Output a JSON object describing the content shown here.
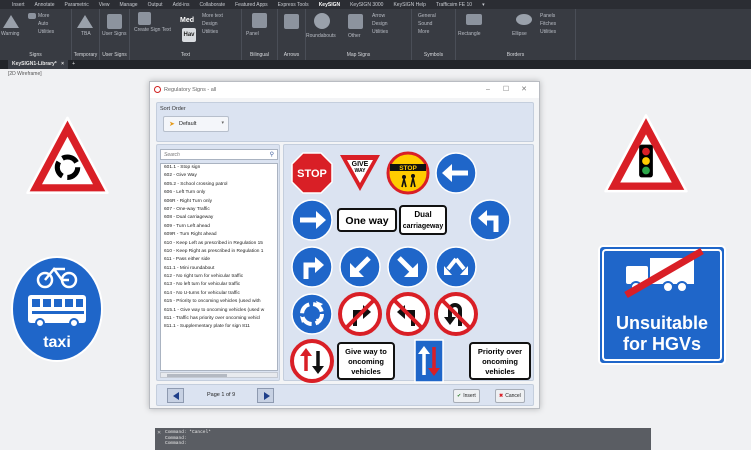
{
  "menubar": [
    "Insert",
    "Annotate",
    "Parametric",
    "View",
    "Manage",
    "Output",
    "Add-ins",
    "Collaborate",
    "Featured Apps",
    "Express Tools",
    "KeySIGN",
    "KeySIGN 3000",
    "KeySIGN Help",
    "Trafficsim FE 10",
    "▾"
  ],
  "ribbon": {
    "panels": [
      "Signs",
      "Temporary",
      "User Signs",
      "Text",
      "Bilingual",
      "Arrows",
      "Map Signs",
      "Symbols",
      "Borders"
    ],
    "items": {
      "more": "More",
      "warning": "Warning",
      "auto": "Auto",
      "utilities": "Utilities",
      "tba": "TBA",
      "user_signs": "User Signs",
      "med": "Med",
      "more_text": "More text",
      "design": "Design",
      "create_sign_text": "Create Sign Text",
      "hav": "Hav",
      "panel": "Panel",
      "roundabouts": "Roundabouts",
      "other": "Other",
      "arrow": "Arrow",
      "general": "General",
      "sound": "Sound",
      "rectangle": "Rectangle",
      "ellipse": "Ellipse",
      "panels": "Panels",
      "fitches": "Fitches"
    }
  },
  "tabs": {
    "drawing": "KeySIGN1-Library*",
    "close": "×",
    "add": "+"
  },
  "viewport_label": "[2D Wireframe]",
  "bg_signs": {
    "taxi_text": "taxi",
    "hgv_line1": "Unsuitable",
    "hgv_line2": "for HGVs"
  },
  "dialog": {
    "title": "Regulatory Signs - all",
    "sort_label": "Sort Order",
    "sort_value": "Default",
    "search_placeholder": "Search",
    "items": [
      "601.1 - Stop sign",
      "602 - Give Way",
      "605.2 - School crossing patrol",
      "606 - Left Turn only",
      "606R - Right Turn only",
      "607 - One-way Traffic",
      "608 - Dual carriageway",
      "609 - Turn Left ahead",
      "609R - Turn Right ahead",
      "610 - Keep Left as prescribed in Regulation 15",
      "610 - Keep Right as prescribed in Regulation 1",
      "611 - Pass either side",
      "611.1 - Mini roundabout",
      "612 - No right turn for vehicular traffic",
      "613 - No left turn for vehicular traffic",
      "614 - No U-turns for vehicular traffic",
      "615 - Priority to oncoming vehicles (used with",
      "615.1 - Give way to oncoming vehicles (used w",
      "811 - Traffic has priority over oncoming vehicl",
      "811.1 - Supplementary plate for sign 811"
    ],
    "signs": {
      "stop": "STOP",
      "give_way_1": "GIVE",
      "give_way_2": "WAY",
      "school_stop": "STOP",
      "one_way": "One way",
      "dual_1": "Dual",
      "dual_2": "carriageway",
      "give_oncoming_1": "Give way to",
      "give_oncoming_2": "oncoming",
      "give_oncoming_3": "vehicles",
      "priority_1": "Priority over",
      "priority_2": "oncoming",
      "priority_3": "vehicles"
    },
    "page_text": "Page 1 of 9",
    "insert_label": "Insert",
    "cancel_label": "Cancel"
  },
  "command_lines": [
    "Command: *Cancel*",
    "Command:",
    "Command:"
  ],
  "colors": {
    "red": "#d91f26",
    "blue": "#1f66c9",
    "yellow": "#ffcc00",
    "dialog_panel": "#dbe3f1"
  }
}
